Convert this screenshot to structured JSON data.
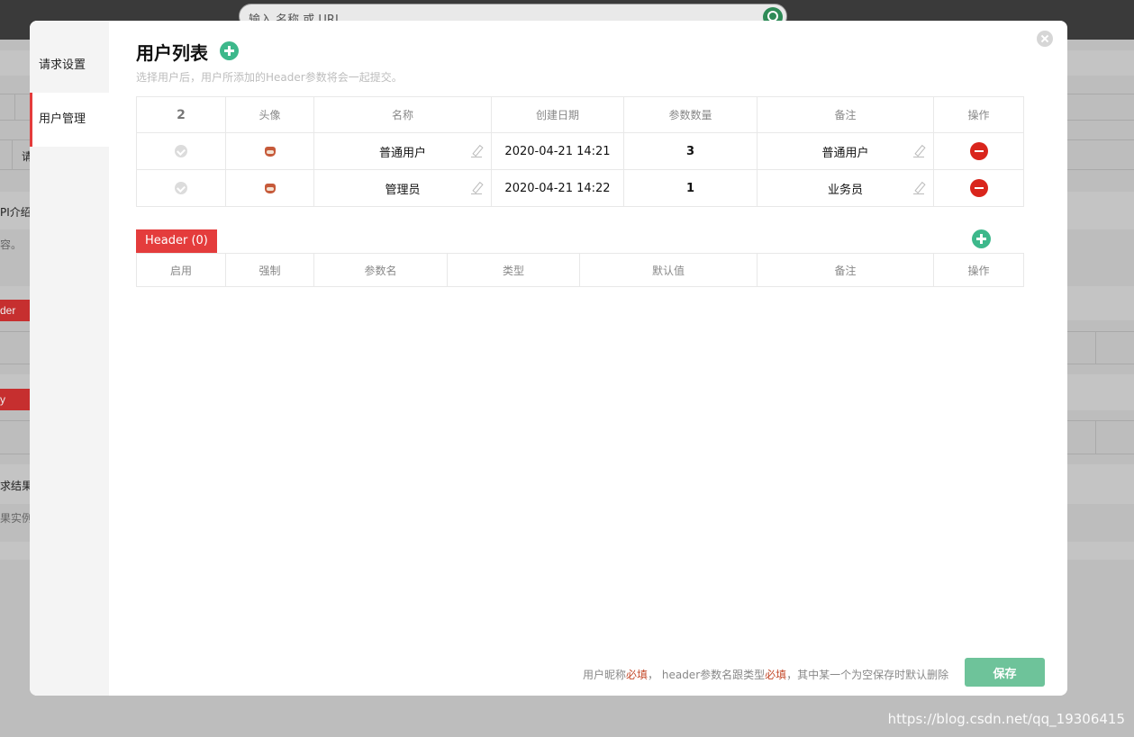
{
  "background": {
    "search_placeholder": "输入 名称 或 URL",
    "side_texts": [
      "请",
      "PI介绍",
      "容。",
      "der",
      "y",
      "求结果",
      "果实例"
    ],
    "watermark": "https://blog.csdn.net/qq_19306415"
  },
  "modal": {
    "sidebar": {
      "items": [
        {
          "label": "请求设置"
        },
        {
          "label": "用户管理"
        }
      ],
      "active": "用户管理"
    },
    "title": "用户列表",
    "subtitle": "选择用户后，用户所添加的Header参数将会一起提交。",
    "users_table": {
      "count": "2",
      "headers": [
        "头像",
        "名称",
        "创建日期",
        "参数数量",
        "备注",
        "操作"
      ],
      "rows": [
        {
          "name": "普通用户",
          "date": "2020-04-21 14:21",
          "params": "3",
          "note": "普通用户"
        },
        {
          "name": "管理员",
          "date": "2020-04-21 14:22",
          "params": "1",
          "note": "业务员"
        }
      ]
    },
    "header_section": {
      "tag": "Header  (0)",
      "headers": [
        "启用",
        "强制",
        "参数名",
        "类型",
        "默认值",
        "备注",
        "操作"
      ]
    },
    "footer": {
      "note_parts": [
        "用户昵称",
        "必填",
        "，  header参数名跟类型",
        "必填",
        "，其中某一个为空保存时默认删除"
      ],
      "save_label": "保存"
    }
  },
  "colors": {
    "accent_red": "#e43c3c",
    "accent_green": "#3db88b",
    "save_green": "#6ec39a",
    "delete_red": "#d9251c"
  }
}
